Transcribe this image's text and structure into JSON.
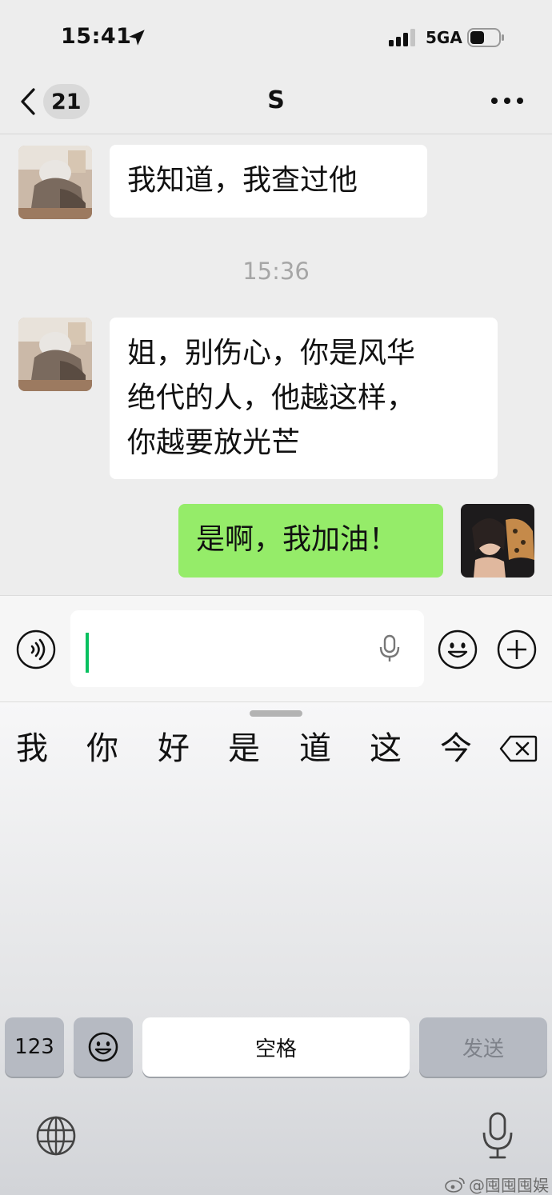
{
  "status_bar": {
    "time": "15:41",
    "network": "5GA",
    "icons": [
      "location-arrow-icon",
      "signal-bars-icon",
      "battery-icon"
    ]
  },
  "nav": {
    "unread_count": "21",
    "title": "S",
    "icons": [
      "chevron-left-icon",
      "more-dots-icon"
    ]
  },
  "messages": [
    {
      "side": "in",
      "text": "我知道，我查过他"
    },
    {
      "time_separator": "15:36"
    },
    {
      "side": "in",
      "lines": [
        "姐，别伤心，你是风华",
        "绝代的人，他越这样，",
        "你越要放光芒"
      ]
    },
    {
      "side": "out",
      "text": "是啊，我加油！"
    }
  ],
  "input_bar": {
    "icons": [
      "voice-icon",
      "mic-icon",
      "emoji-icon",
      "plus-icon"
    ],
    "value": ""
  },
  "keyboard": {
    "candidates": [
      "我",
      "你",
      "好",
      "是",
      "道",
      "这",
      "今天"
    ],
    "keys": {
      "numeric": "123",
      "space": "空格",
      "send": "发送"
    },
    "icons": [
      "delete-icon",
      "emoji-key-icon",
      "globe-icon",
      "dictation-mic-icon"
    ]
  },
  "watermark": "@囤囤囤娱"
}
